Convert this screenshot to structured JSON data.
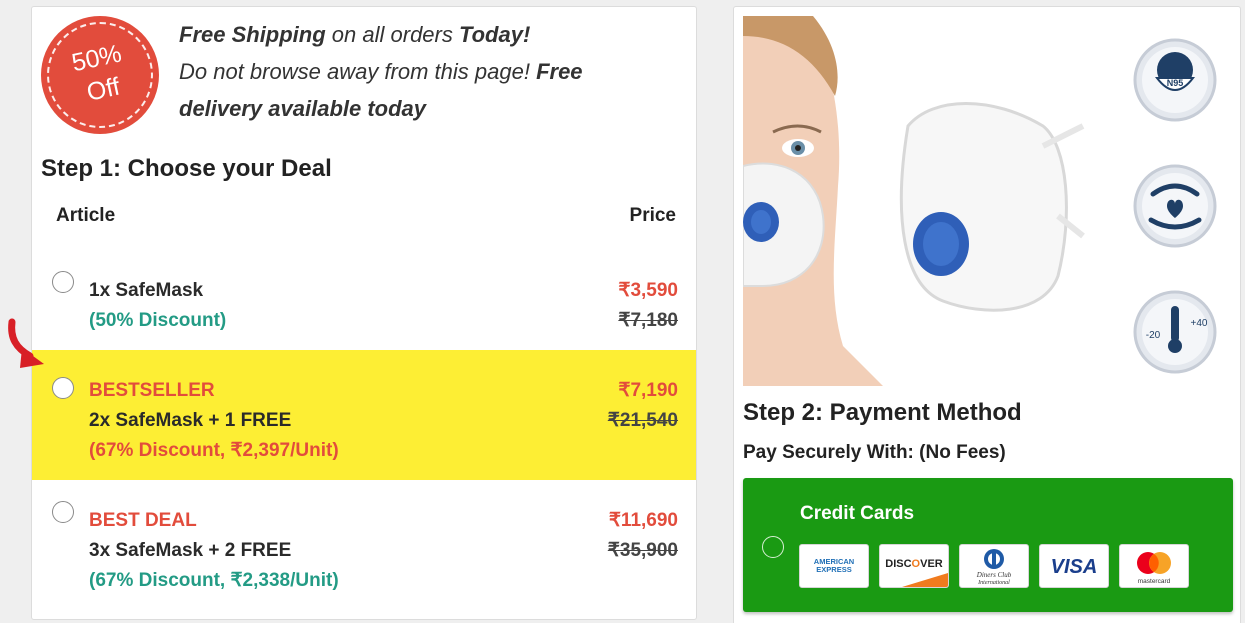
{
  "badge": {
    "line1": "50%",
    "line2": "Off"
  },
  "promo": {
    "free_shipping": "Free Shipping",
    "on_all_orders": " on all orders ",
    "today": "Today!",
    "dont_browse": "Do not browse away from this page! ",
    "free": "Free",
    "delivery": "delivery available today"
  },
  "step1": {
    "title": "Step 1: Choose your Deal",
    "col_article": "Article",
    "col_price": "Price"
  },
  "deals": [
    {
      "line1": "1x SafeMask",
      "line2": "(50% Discount)",
      "price": "₹3,590",
      "old_price": "₹7,180",
      "selected": false
    },
    {
      "tag": "BESTSELLER",
      "line1": "2x SafeMask + 1 FREE",
      "line2": "(67% Discount, ₹2,397/Unit)",
      "price": "₹7,190",
      "old_price": "₹21,540",
      "selected": false,
      "highlighted": true
    },
    {
      "tag": "BEST DEAL",
      "line1": "3x SafeMask + 2 FREE",
      "line2": "(67% Discount, ₹2,338/Unit)",
      "price": "₹11,690",
      "old_price": "₹35,900",
      "selected": false
    }
  ],
  "features": {
    "n95_label": "N95",
    "temp_low": "-20",
    "temp_high": "+40"
  },
  "step2": {
    "title": "Step 2: Payment Method",
    "subtitle": "Pay Securely With: (No Fees)",
    "credit_cards_label": "Credit Cards",
    "cards": [
      "AMERICAN EXPRESS",
      "DISCOVER",
      "Diners Club International",
      "VISA",
      "mastercard"
    ]
  },
  "colors": {
    "accent_red": "#e24c3c",
    "discount_green": "#239b85",
    "highlight_yellow": "#fdee34",
    "payment_green": "#1a9a13"
  },
  "icons": [
    "n95-mask-icon",
    "protection-hands-icon",
    "thermometer-icon",
    "arrow-icon"
  ]
}
